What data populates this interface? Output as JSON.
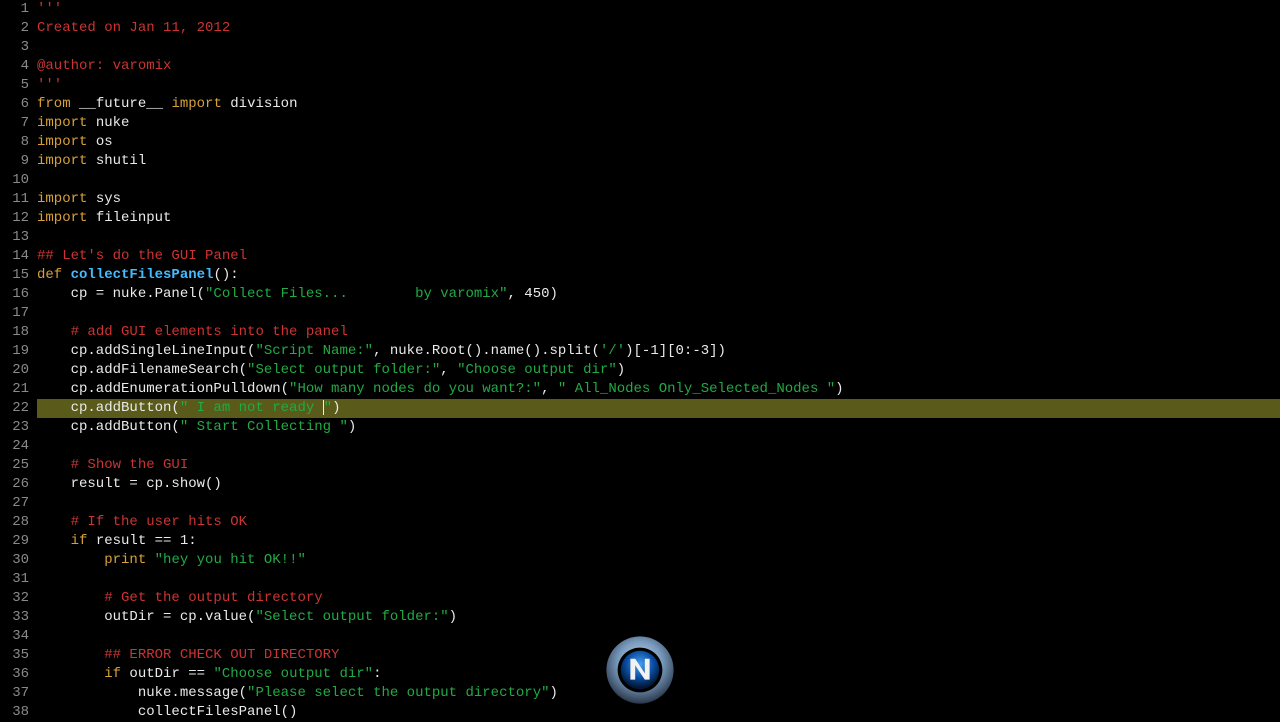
{
  "watermark": {
    "name": "cmivfx-logo"
  },
  "highlight_line": 22,
  "lines": [
    {
      "n": "1",
      "tokens": [
        {
          "t": "'''",
          "c": "comment"
        }
      ]
    },
    {
      "n": "2",
      "tokens": [
        {
          "t": "Created on Jan 11, 2012",
          "c": "comment"
        }
      ]
    },
    {
      "n": "3",
      "tokens": []
    },
    {
      "n": "4",
      "tokens": [
        {
          "t": "@author: varomix",
          "c": "comment"
        }
      ]
    },
    {
      "n": "5",
      "tokens": [
        {
          "t": "'''",
          "c": "comment"
        }
      ]
    },
    {
      "n": "6",
      "tokens": [
        {
          "t": "from",
          "c": "keyword"
        },
        {
          "t": " __future__ ",
          "c": "plain"
        },
        {
          "t": "import",
          "c": "keyword"
        },
        {
          "t": " division",
          "c": "plain"
        }
      ]
    },
    {
      "n": "7",
      "tokens": [
        {
          "t": "import",
          "c": "keyword"
        },
        {
          "t": " nuke",
          "c": "plain"
        }
      ]
    },
    {
      "n": "8",
      "tokens": [
        {
          "t": "import",
          "c": "keyword"
        },
        {
          "t": " os",
          "c": "plain"
        }
      ]
    },
    {
      "n": "9",
      "tokens": [
        {
          "t": "import",
          "c": "keyword"
        },
        {
          "t": " shutil",
          "c": "plain"
        }
      ]
    },
    {
      "n": "10",
      "tokens": []
    },
    {
      "n": "11",
      "tokens": [
        {
          "t": "import",
          "c": "keyword"
        },
        {
          "t": " sys",
          "c": "plain"
        }
      ]
    },
    {
      "n": "12",
      "tokens": [
        {
          "t": "import",
          "c": "keyword"
        },
        {
          "t": " fileinput",
          "c": "plain"
        }
      ]
    },
    {
      "n": "13",
      "tokens": []
    },
    {
      "n": "14",
      "tokens": [
        {
          "t": "## Let's do the GUI Panel",
          "c": "comment"
        }
      ]
    },
    {
      "n": "15",
      "tokens": [
        {
          "t": "def ",
          "c": "keyword"
        },
        {
          "t": "collectFilesPanel",
          "c": "funcname"
        },
        {
          "t": "():",
          "c": "plain"
        }
      ]
    },
    {
      "n": "16",
      "tokens": [
        {
          "t": "    cp = nuke.Panel(",
          "c": "plain"
        },
        {
          "t": "\"Collect Files...        by varomix\"",
          "c": "string"
        },
        {
          "t": ", 450)",
          "c": "plain"
        }
      ]
    },
    {
      "n": "17",
      "tokens": []
    },
    {
      "n": "18",
      "tokens": [
        {
          "t": "    ",
          "c": "plain"
        },
        {
          "t": "# add GUI elements into the panel",
          "c": "comment"
        }
      ]
    },
    {
      "n": "19",
      "tokens": [
        {
          "t": "    cp.addSingleLineInput(",
          "c": "plain"
        },
        {
          "t": "\"Script Name:\"",
          "c": "string"
        },
        {
          "t": ", nuke.Root().name().split(",
          "c": "plain"
        },
        {
          "t": "'/'",
          "c": "string"
        },
        {
          "t": ")[-1][0:-3])",
          "c": "plain"
        }
      ]
    },
    {
      "n": "20",
      "tokens": [
        {
          "t": "    cp.addFilenameSearch(",
          "c": "plain"
        },
        {
          "t": "\"Select output folder:\"",
          "c": "string"
        },
        {
          "t": ", ",
          "c": "plain"
        },
        {
          "t": "\"Choose output dir\"",
          "c": "string"
        },
        {
          "t": ")",
          "c": "plain"
        }
      ]
    },
    {
      "n": "21",
      "tokens": [
        {
          "t": "    cp.addEnumerationPulldown(",
          "c": "plain"
        },
        {
          "t": "\"How many nodes do you want?:\"",
          "c": "string"
        },
        {
          "t": ", ",
          "c": "plain"
        },
        {
          "t": "\" All_Nodes Only_Selected_Nodes \"",
          "c": "string"
        },
        {
          "t": ")",
          "c": "plain"
        }
      ]
    },
    {
      "n": "22",
      "tokens": [
        {
          "t": "    cp.addButton(",
          "c": "plain"
        },
        {
          "t": "\" I am not ready ",
          "c": "string"
        },
        {
          "t": "",
          "c": "caret"
        },
        {
          "t": "\"",
          "c": "string"
        },
        {
          "t": ")",
          "c": "plain"
        }
      ]
    },
    {
      "n": "23",
      "tokens": [
        {
          "t": "    cp.addButton(",
          "c": "plain"
        },
        {
          "t": "\" Start Collecting \"",
          "c": "string"
        },
        {
          "t": ")",
          "c": "plain"
        }
      ]
    },
    {
      "n": "24",
      "tokens": []
    },
    {
      "n": "25",
      "tokens": [
        {
          "t": "    ",
          "c": "plain"
        },
        {
          "t": "# Show the GUI",
          "c": "comment"
        }
      ]
    },
    {
      "n": "26",
      "tokens": [
        {
          "t": "    result = cp.show()",
          "c": "plain"
        }
      ]
    },
    {
      "n": "27",
      "tokens": []
    },
    {
      "n": "28",
      "tokens": [
        {
          "t": "    ",
          "c": "plain"
        },
        {
          "t": "# If the user hits OK",
          "c": "comment"
        }
      ]
    },
    {
      "n": "29",
      "tokens": [
        {
          "t": "    ",
          "c": "plain"
        },
        {
          "t": "if",
          "c": "keyword"
        },
        {
          "t": " result == 1:",
          "c": "plain"
        }
      ]
    },
    {
      "n": "30",
      "tokens": [
        {
          "t": "        ",
          "c": "plain"
        },
        {
          "t": "print",
          "c": "keyword"
        },
        {
          "t": " ",
          "c": "plain"
        },
        {
          "t": "\"hey you hit OK!!\"",
          "c": "string"
        }
      ]
    },
    {
      "n": "31",
      "tokens": []
    },
    {
      "n": "32",
      "tokens": [
        {
          "t": "        ",
          "c": "plain"
        },
        {
          "t": "# Get the output directory",
          "c": "comment"
        }
      ]
    },
    {
      "n": "33",
      "tokens": [
        {
          "t": "        outDir = cp.value(",
          "c": "plain"
        },
        {
          "t": "\"Select output folder:\"",
          "c": "string"
        },
        {
          "t": ")",
          "c": "plain"
        }
      ]
    },
    {
      "n": "34",
      "tokens": []
    },
    {
      "n": "35",
      "tokens": [
        {
          "t": "        ",
          "c": "plain"
        },
        {
          "t": "## ERROR CHECK OUT DIRECTORY",
          "c": "comment"
        }
      ]
    },
    {
      "n": "36",
      "tokens": [
        {
          "t": "        ",
          "c": "plain"
        },
        {
          "t": "if",
          "c": "keyword"
        },
        {
          "t": " outDir == ",
          "c": "plain"
        },
        {
          "t": "\"Choose output dir\"",
          "c": "string"
        },
        {
          "t": ":",
          "c": "plain"
        }
      ]
    },
    {
      "n": "37",
      "tokens": [
        {
          "t": "            nuke.message(",
          "c": "plain"
        },
        {
          "t": "\"Please select the output directory\"",
          "c": "string"
        },
        {
          "t": ")",
          "c": "plain"
        }
      ]
    },
    {
      "n": "38",
      "tokens": [
        {
          "t": "            collectFilesPanel()",
          "c": "plain"
        }
      ]
    }
  ]
}
